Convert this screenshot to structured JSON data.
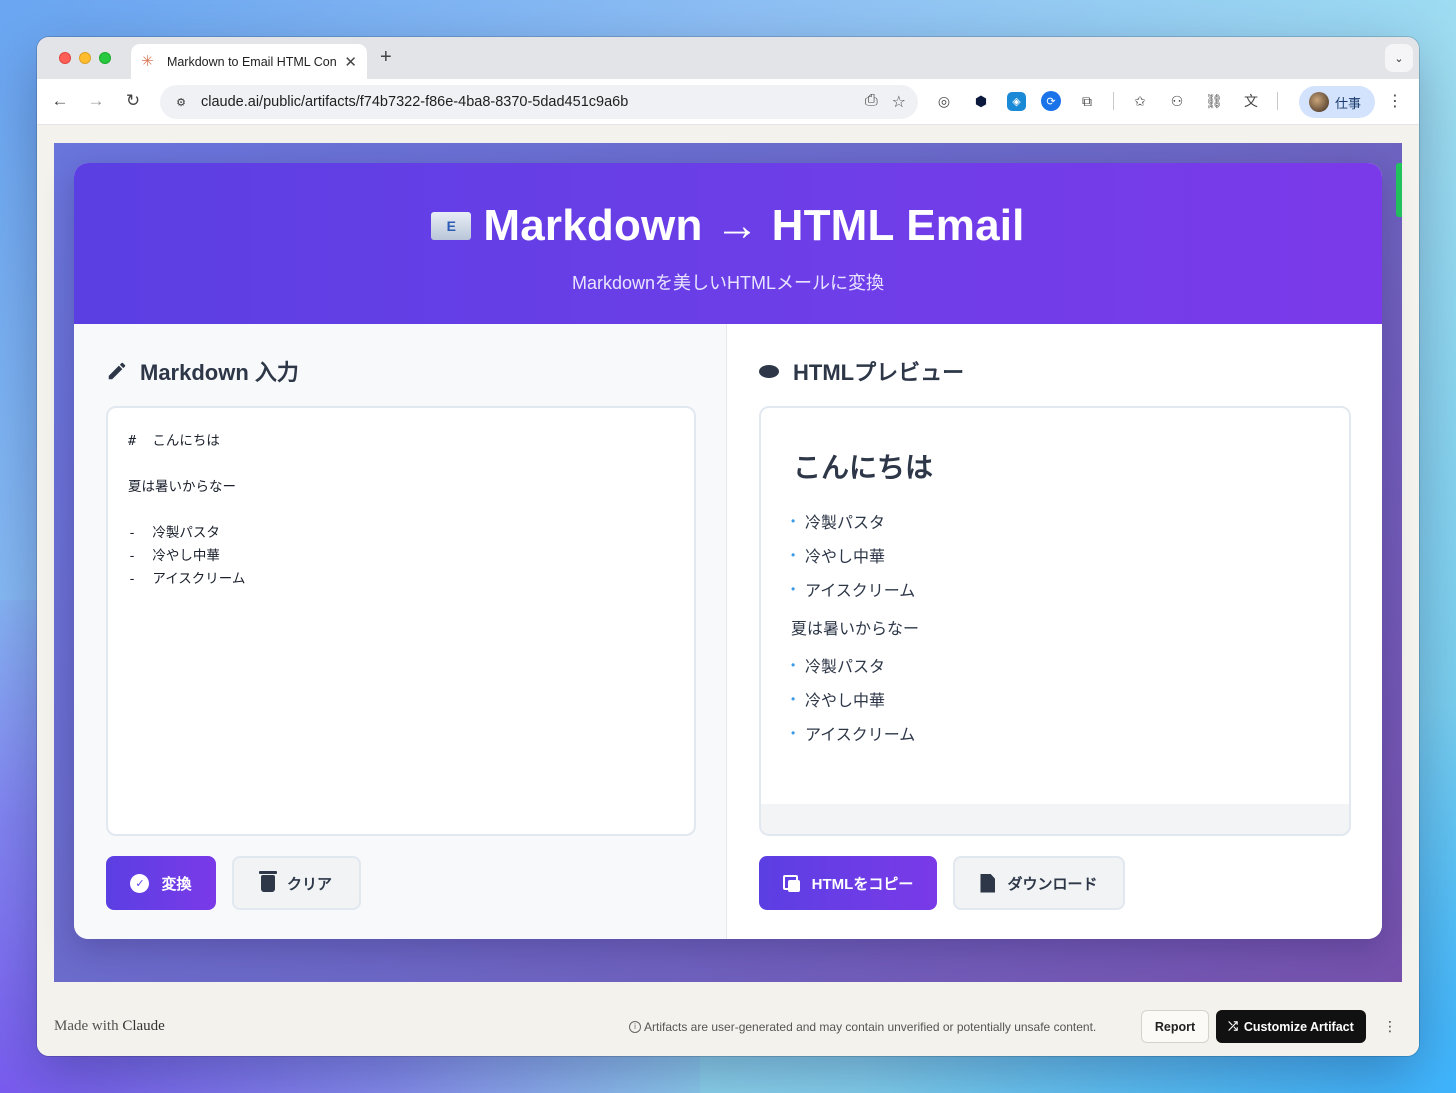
{
  "browser": {
    "tab_title": "Markdown to Email HTML Con",
    "tab_favicon": "✳",
    "url": "claude.ai/public/artifacts/f74b7322-f86e-4ba8-8370-5dad451c9a6b",
    "profile_label": "仕事"
  },
  "hero": {
    "icon": "E",
    "title": "Markdown → HTML Email",
    "subtitle": "Markdownを美しいHTMLメールに変換"
  },
  "input_panel": {
    "heading": "Markdown 入力",
    "lines": [
      "#  こんにちは",
      "",
      "夏は暑いからなー",
      "",
      "-  冷製パスタ",
      "-  冷やし中華",
      "-  アイスクリーム"
    ],
    "convert_label": "変換",
    "clear_label": "クリア"
  },
  "preview_panel": {
    "heading": "HTMLプレビュー",
    "h1": "こんにちは",
    "list_a": [
      "冷製パスタ",
      "冷やし中華",
      "アイスクリーム"
    ],
    "paragraph": "夏は暑いからなー",
    "list_b": [
      "冷製パスタ",
      "冷やし中華",
      "アイスクリーム"
    ],
    "copy_label": "HTMLをコピー",
    "download_label": "ダウンロード"
  },
  "footer": {
    "made_with_prefix": "Made with",
    "made_with_brand": "Claude",
    "disclaimer": "Artifacts are user-generated and may contain unverified or potentially unsafe content.",
    "report_label": "Report",
    "customize_label": "Customize Artifact"
  }
}
